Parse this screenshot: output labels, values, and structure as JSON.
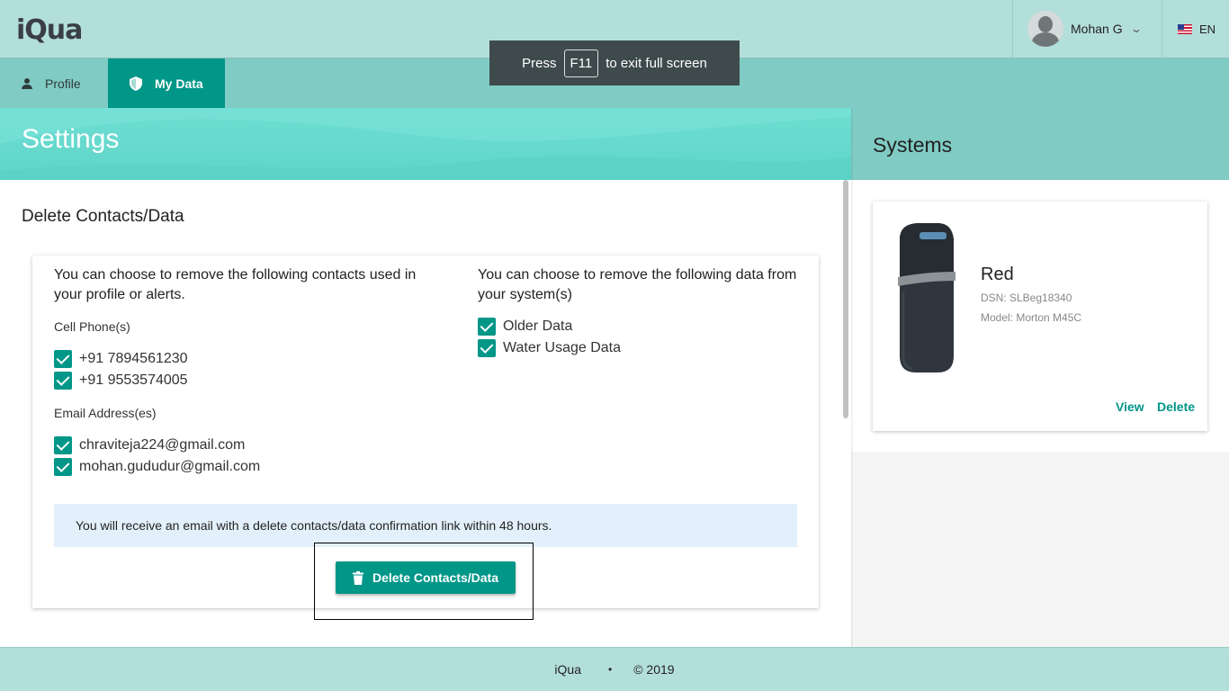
{
  "header": {
    "logo": "iQua",
    "user_name": "Mohan G",
    "language": "EN"
  },
  "toast": {
    "prefix": "Press",
    "key": "F11",
    "suffix": "to exit full screen"
  },
  "tabs": [
    {
      "label": "Profile",
      "icon": "person-icon",
      "active": false
    },
    {
      "label": "My Data",
      "icon": "shield-icon",
      "active": true
    }
  ],
  "settings": {
    "title": "Settings",
    "section_title": "Delete Contacts/Data",
    "contacts_intro": "You can choose to remove the following contacts used in your profile or alerts.",
    "data_intro": "You can choose to remove the following data from your system(s)",
    "phones_label": "Cell Phone(s)",
    "phones": [
      "+91 7894561230",
      "+91 9553574005"
    ],
    "emails_label": "Email Address(es)",
    "emails": [
      "chraviteja224@gmail.com",
      "mohan.gududur@gmail.com"
    ],
    "data_items": [
      "Older Data",
      "Water Usage Data"
    ],
    "info_text": "You will receive an email with a delete contacts/data confirmation link within 48 hours.",
    "delete_button": "Delete Contacts/Data"
  },
  "systems": {
    "title": "Systems",
    "card": {
      "name": "Red",
      "dsn": "DSN: SLBeg18340",
      "model": "Model: Morton M45C",
      "view_label": "View",
      "delete_label": "Delete"
    }
  },
  "footer": {
    "brand": "iQua",
    "copyright": "© 2019"
  },
  "colors": {
    "primary": "#009688",
    "header_bg": "#b3dfdb",
    "tabbar_bg": "#80cbc4",
    "info_bg": "#e3f0fb"
  }
}
